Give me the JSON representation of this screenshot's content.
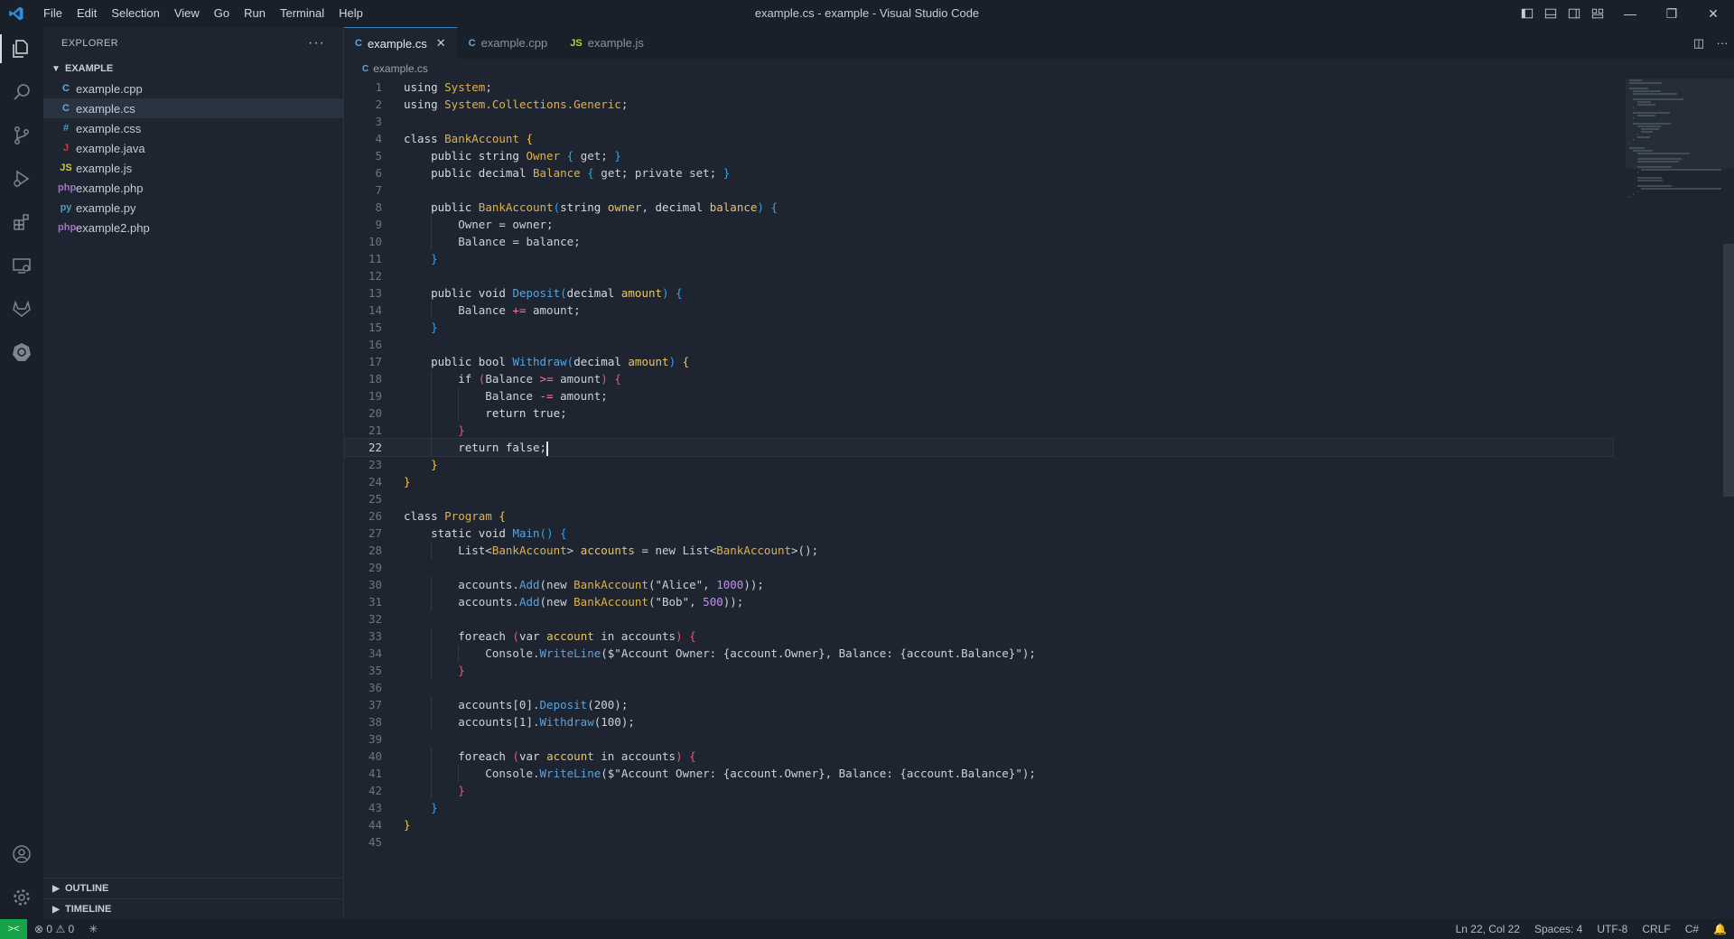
{
  "window": {
    "title": "example.cs - example - Visual Studio Code"
  },
  "menu": [
    "File",
    "Edit",
    "Selection",
    "View",
    "Go",
    "Run",
    "Terminal",
    "Help"
  ],
  "sidebar": {
    "title": "EXPLORER",
    "folder": "EXAMPLE",
    "files": [
      {
        "name": "example.cpp",
        "icon": "C",
        "color": "#6aa6d8"
      },
      {
        "name": "example.cs",
        "icon": "C",
        "color": "#6aa6d8"
      },
      {
        "name": "example.css",
        "icon": "#",
        "color": "#519aba"
      },
      {
        "name": "example.java",
        "icon": "J",
        "color": "#cc3e44"
      },
      {
        "name": "example.js",
        "icon": "JS",
        "color": "#cbcb41"
      },
      {
        "name": "example.php",
        "icon": "php",
        "color": "#a074c4"
      },
      {
        "name": "example.py",
        "icon": "py",
        "color": "#519aba"
      },
      {
        "name": "example2.php",
        "icon": "php",
        "color": "#a074c4"
      }
    ],
    "selected_file": "example.cs",
    "outline": "OUTLINE",
    "timeline": "TIMELINE"
  },
  "tabs": [
    {
      "label": "example.cs",
      "icon": "C",
      "color": "#6aa6d8",
      "active": true
    },
    {
      "label": "example.cpp",
      "icon": "C",
      "color": "#6aa6d8",
      "active": false
    },
    {
      "label": "example.js",
      "icon": "JS",
      "color": "#cbcb41",
      "active": false
    }
  ],
  "breadcrumb": "example.cs",
  "current_line": 22,
  "code": [
    [
      [
        "kw",
        "using "
      ],
      [
        "type",
        "System"
      ],
      [
        "",
        "; "
      ]
    ],
    [
      [
        "kw",
        "using "
      ],
      [
        "type",
        "System.Collections.Generic"
      ],
      [
        "",
        ";"
      ]
    ],
    [],
    [
      [
        "kw",
        "class "
      ],
      [
        "cls",
        "BankAccount "
      ],
      [
        "b1",
        "{"
      ]
    ],
    [
      [
        "kw",
        "    public "
      ],
      [
        "kw",
        "string "
      ],
      [
        "type",
        "Owner "
      ],
      [
        "b2",
        "{ "
      ],
      [
        "",
        "get; "
      ],
      [
        "b2",
        "}"
      ]
    ],
    [
      [
        "kw",
        "    public "
      ],
      [
        "kw",
        "decimal "
      ],
      [
        "type",
        "Balance "
      ],
      [
        "b2",
        "{ "
      ],
      [
        "",
        "get; private set; "
      ],
      [
        "b2",
        "}"
      ]
    ],
    [],
    [
      [
        "kw",
        "    public "
      ],
      [
        "cls",
        "BankAccount"
      ],
      [
        "b2",
        "("
      ],
      [
        "kw",
        "string "
      ],
      [
        "var",
        "owner"
      ],
      [
        "",
        ", "
      ],
      [
        "kw",
        "decimal "
      ],
      [
        "var",
        "balance"
      ],
      [
        "b2",
        ") {"
      ]
    ],
    [
      [
        "",
        "        Owner = owner;"
      ]
    ],
    [
      [
        "",
        "        Balance = balance;"
      ]
    ],
    [
      [
        "b2",
        "    }"
      ]
    ],
    [],
    [
      [
        "kw",
        "    public "
      ],
      [
        "kw",
        "void "
      ],
      [
        "fn",
        "Deposit"
      ],
      [
        "b2",
        "("
      ],
      [
        "kw",
        "decimal "
      ],
      [
        "var",
        "amount"
      ],
      [
        "b2",
        ") {"
      ]
    ],
    [
      [
        "",
        "        Balance "
      ],
      [
        "op",
        "+="
      ],
      [
        "",
        " amount;"
      ]
    ],
    [
      [
        "b2",
        "    }"
      ]
    ],
    [],
    [
      [
        "kw",
        "    public "
      ],
      [
        "kw",
        "bool "
      ],
      [
        "fn",
        "Withdraw"
      ],
      [
        "b2",
        "("
      ],
      [
        "kw",
        "decimal "
      ],
      [
        "var",
        "amount"
      ],
      [
        "b2",
        ") "
      ],
      [
        "b1",
        "{"
      ]
    ],
    [
      [
        "kw",
        "        if "
      ],
      [
        "b3",
        "("
      ],
      [
        "",
        "Balance "
      ],
      [
        "op",
        ">="
      ],
      [
        "",
        " amount"
      ],
      [
        "b3",
        ") {"
      ]
    ],
    [
      [
        "",
        "            Balance "
      ],
      [
        "op",
        "-="
      ],
      [
        "",
        " amount;"
      ]
    ],
    [
      [
        "kw",
        "            return "
      ],
      [
        "kw",
        "true"
      ],
      [
        "",
        ";"
      ]
    ],
    [
      [
        "b3",
        "        }"
      ]
    ],
    [
      [
        "kw",
        "        return "
      ],
      [
        "kw",
        "false"
      ],
      [
        "",
        ";"
      ]
    ],
    [
      [
        "b1",
        "    }"
      ]
    ],
    [
      [
        "b1",
        "}"
      ]
    ],
    [],
    [
      [
        "kw",
        "class "
      ],
      [
        "cls",
        "Program "
      ],
      [
        "b1",
        "{"
      ]
    ],
    [
      [
        "kw",
        "    static "
      ],
      [
        "kw",
        "void "
      ],
      [
        "fn",
        "Main"
      ],
      [
        "b2",
        "() {"
      ]
    ],
    [
      [
        "",
        "        List<"
      ],
      [
        "cls",
        "BankAccount"
      ],
      [
        "",
        "> "
      ],
      [
        "var",
        "accounts"
      ],
      [
        "",
        " = new List<"
      ],
      [
        "cls",
        "BankAccount"
      ],
      [
        "",
        ">();"
      ]
    ],
    [],
    [
      [
        "",
        "        accounts."
      ],
      [
        "fn",
        "Add"
      ],
      [
        "",
        "(new "
      ],
      [
        "cls",
        "BankAccount"
      ],
      [
        "",
        "(\"Alice\", "
      ],
      [
        "num",
        "1000"
      ],
      [
        "",
        "));"
      ]
    ],
    [
      [
        "",
        "        accounts."
      ],
      [
        "fn",
        "Add"
      ],
      [
        "",
        "(new "
      ],
      [
        "cls",
        "BankAccount"
      ],
      [
        "",
        "(\"Bob\", "
      ],
      [
        "num",
        "500"
      ],
      [
        "",
        "));"
      ]
    ],
    [],
    [
      [
        "kw",
        "        foreach "
      ],
      [
        "b3",
        "("
      ],
      [
        "kw",
        "var "
      ],
      [
        "var",
        "account"
      ],
      [
        "",
        " in accounts"
      ],
      [
        "b3",
        ") {"
      ]
    ],
    [
      [
        "",
        "            Console."
      ],
      [
        "fn",
        "WriteLine"
      ],
      [
        "",
        "($\"Account Owner: {account.Owner}, Balance: {account.Balance}\");"
      ]
    ],
    [
      [
        "b3",
        "        }"
      ]
    ],
    [],
    [
      [
        "",
        "        accounts[0]."
      ],
      [
        "fn",
        "Deposit"
      ],
      [
        "",
        "(200);"
      ]
    ],
    [
      [
        "",
        "        accounts[1]."
      ],
      [
        "fn",
        "Withdraw"
      ],
      [
        "",
        "(100);"
      ]
    ],
    [],
    [
      [
        "kw",
        "        foreach "
      ],
      [
        "b3",
        "("
      ],
      [
        "kw",
        "var "
      ],
      [
        "var",
        "account"
      ],
      [
        "",
        " in accounts"
      ],
      [
        "b3",
        ") {"
      ]
    ],
    [
      [
        "",
        "            Console."
      ],
      [
        "fn",
        "WriteLine"
      ],
      [
        "",
        "($\"Account Owner: {account.Owner}, Balance: {account.Balance}\");"
      ]
    ],
    [
      [
        "b3",
        "        }"
      ]
    ],
    [
      [
        "b2",
        "    }"
      ]
    ],
    [
      [
        "b1",
        "}"
      ]
    ],
    []
  ],
  "status": {
    "errors": "0",
    "warnings": "0",
    "position": "Ln 22, Col 22",
    "spaces": "Spaces: 4",
    "encoding": "UTF-8",
    "eol": "CRLF",
    "language": "C#"
  },
  "icons": {
    "activity": [
      "explorer-icon",
      "search-icon",
      "source-control-icon",
      "run-debug-icon",
      "extensions-icon",
      "remote-explorer-icon",
      "gitlab-icon",
      "kubernetes-icon"
    ],
    "activity_bottom": [
      "account-icon",
      "settings-gear-icon"
    ]
  }
}
